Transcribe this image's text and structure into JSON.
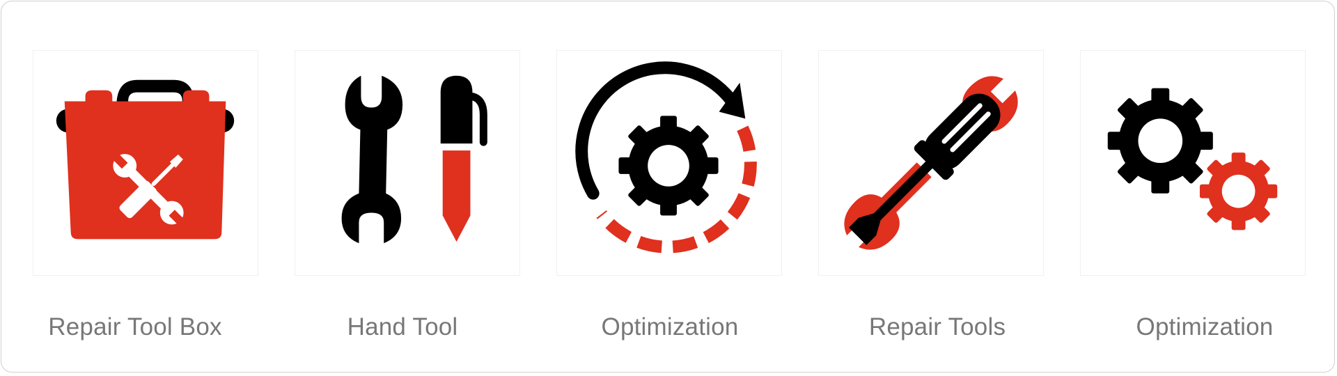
{
  "colors": {
    "accent": "#E0301E",
    "ink": "#000000",
    "label": "#777777",
    "frame_border": "#CFCFCF"
  },
  "icons": [
    {
      "label": "Repair Tool Box",
      "icon": "repair-toolbox-icon"
    },
    {
      "label": "Hand Tool",
      "icon": "wrench-and-marker-icon"
    },
    {
      "label": "Optimization",
      "icon": "gear-with-cycle-arrow-icon"
    },
    {
      "label": "Repair Tools",
      "icon": "crossed-wrench-screwdriver-icon"
    },
    {
      "label": "Optimization",
      "icon": "two-gears-icon"
    }
  ]
}
